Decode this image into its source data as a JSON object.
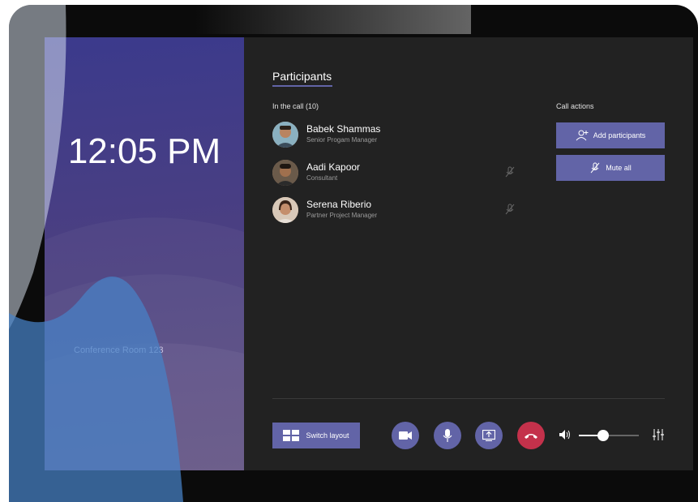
{
  "clock": {
    "time": "12:05 PM"
  },
  "room": {
    "name": "Conference Room 123"
  },
  "participants": {
    "title": "Participants",
    "in_call_label": "In the call (10)",
    "list": [
      {
        "name": "Babek Shammas",
        "role": "Senior Progam Manager",
        "muted": false
      },
      {
        "name": "Aadi Kapoor",
        "role": "Consultant",
        "muted": true
      },
      {
        "name": "Serena Riberio",
        "role": "Partner Project Manager",
        "muted": true
      }
    ]
  },
  "call_actions": {
    "label": "Call actions",
    "add_participants": "Add participants",
    "mute_all": "Mute all"
  },
  "controls": {
    "switch_layout": "Switch layout",
    "volume_level": 0.4
  },
  "colors": {
    "accent": "#6264a7",
    "hangup": "#c4314b",
    "panel": "#222222"
  }
}
